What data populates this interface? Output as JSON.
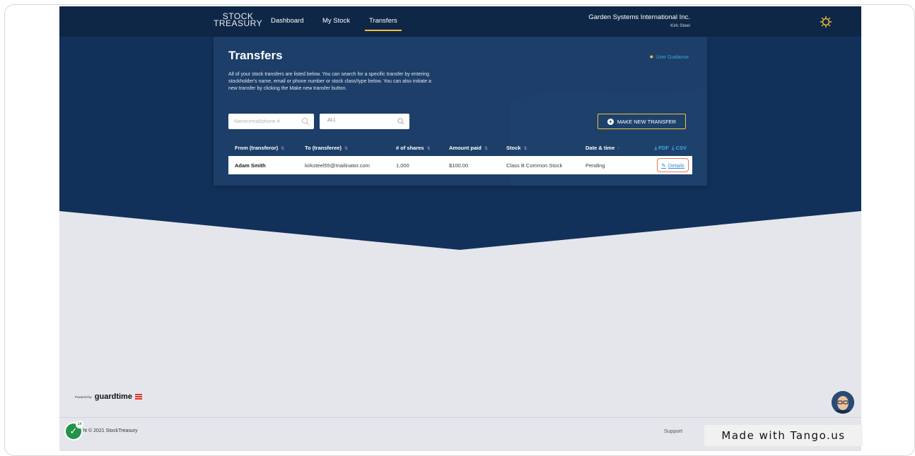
{
  "header": {
    "logo_line1": "STOCK",
    "logo_line2": "TREASURY",
    "nav": [
      {
        "label": "Dashboard"
      },
      {
        "label": "My Stock"
      },
      {
        "label": "Transfers"
      }
    ],
    "active_nav": "Transfers",
    "company": "Garden Systems International Inc.",
    "user": "Kirk Steel"
  },
  "main": {
    "title": "Transfers",
    "user_guidance": "User Guidance",
    "description": "All of your stock transfers are listed below. You can search for a specific transfer by entering stockholder's name, email or phone number or stock class/type below. You can also initiate a new transfer by clicking the Make new transfer button.",
    "search_placeholder": "Name/email/phone #",
    "filter_value": "ALL",
    "make_transfer_label": "MAKE NEW TRANSFER",
    "columns": [
      "From (transferor)",
      "To (transferee)",
      "# of shares",
      "Amount paid",
      "Stock",
      "Date & time"
    ],
    "export_pdf": "PDF",
    "export_csv": "CSV",
    "rows": [
      {
        "from": "Adam Smith",
        "to": "kirksteel55@mailinator.com",
        "shares": "1,000",
        "amount": "$100.00",
        "stock": "Class B Common Stock",
        "date": "Pending",
        "action": "Details"
      }
    ]
  },
  "footer": {
    "powered_by": "Powered by",
    "brand": "guardtime",
    "copyright": "yright © 2021 StockTreasury",
    "support": "Support"
  },
  "overlay": {
    "tango": "Made with Tango.us",
    "check_badge": "14"
  },
  "colors": {
    "navy": "#0f2746",
    "card": "#1c3e68",
    "accent_yellow": "#f2c23b",
    "link_blue": "#2f8fd1",
    "highlight": "#e8785a"
  }
}
